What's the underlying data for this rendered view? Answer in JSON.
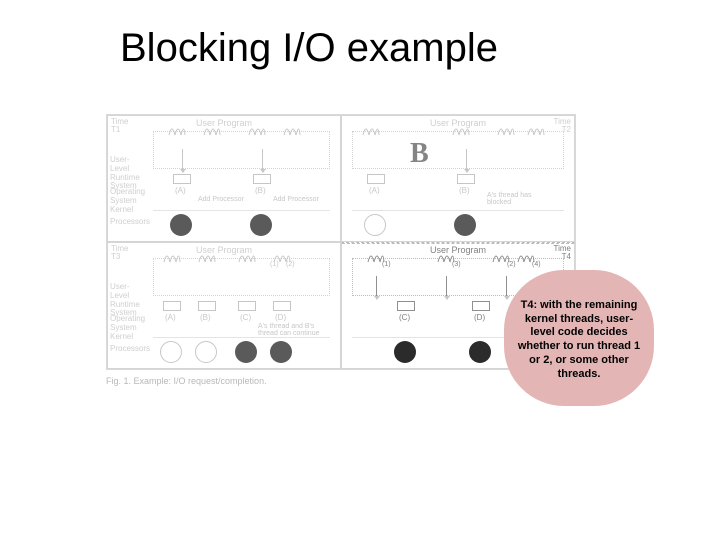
{
  "title": "Blocking I/O example",
  "figure": {
    "panel_header": "User Program",
    "row_labels": {
      "time": "Time",
      "userlevel": "User-Level Runtime System",
      "kernel": "Operating System Kernel",
      "processors": "Processors"
    },
    "times": {
      "t1": "T1",
      "t2": "T2",
      "t3": "T3",
      "t4": "T4"
    },
    "proc_labels": {
      "A": "(A)",
      "B": "(B)",
      "C": "(C)",
      "D": "(D)"
    },
    "notes": {
      "add_processor": "Add Processor",
      "as_thread_blocked": "A's thread has blocked",
      "as_bs_continue": "A's thread and B's thread can continue"
    },
    "thread_ids": {
      "t1": "(1)",
      "t2": "(2)",
      "t3": "(3)",
      "t4": "(4)"
    },
    "big_b": "B",
    "caption": "Fig. 1.   Example: I/O request/completion."
  },
  "callout": {
    "text": "T4: with the remaining kernel threads, user-level code decides whether to run thread 1 or 2, or some other threads."
  }
}
